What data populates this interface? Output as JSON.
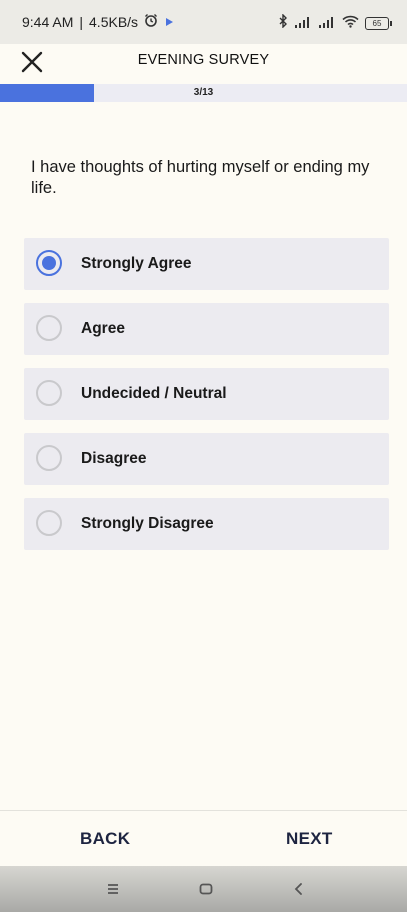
{
  "status_bar": {
    "time": "9:44 AM",
    "separator": "|",
    "net_speed": "4.5KB/s",
    "battery": "65",
    "icons": [
      "alarm-icon",
      "play-icon",
      "bluetooth-icon",
      "signal-icon",
      "signal-icon",
      "wifi-icon",
      "battery-icon"
    ]
  },
  "header": {
    "title": "EVENING SURVEY",
    "close_icon": "close-icon"
  },
  "progress": {
    "label": "3/13",
    "current": 3,
    "total": 13,
    "fill_color": "#4a72de"
  },
  "question": {
    "text": "I have thoughts of hurting myself or ending my life."
  },
  "options": [
    {
      "label": "Strongly Agree",
      "selected": true
    },
    {
      "label": "Agree",
      "selected": false
    },
    {
      "label": "Undecided / Neutral",
      "selected": false
    },
    {
      "label": "Disagree",
      "selected": false
    },
    {
      "label": "Strongly Disagree",
      "selected": false
    }
  ],
  "footer": {
    "back_label": "BACK",
    "next_label": "NEXT"
  },
  "nav_bar": {
    "icons": [
      "menu-icon",
      "home-icon",
      "back-icon"
    ]
  },
  "colors": {
    "accent": "#4a72de",
    "background": "#fdfbf4",
    "option_bg": "#ecebf0",
    "footer_text": "#1d2440"
  }
}
